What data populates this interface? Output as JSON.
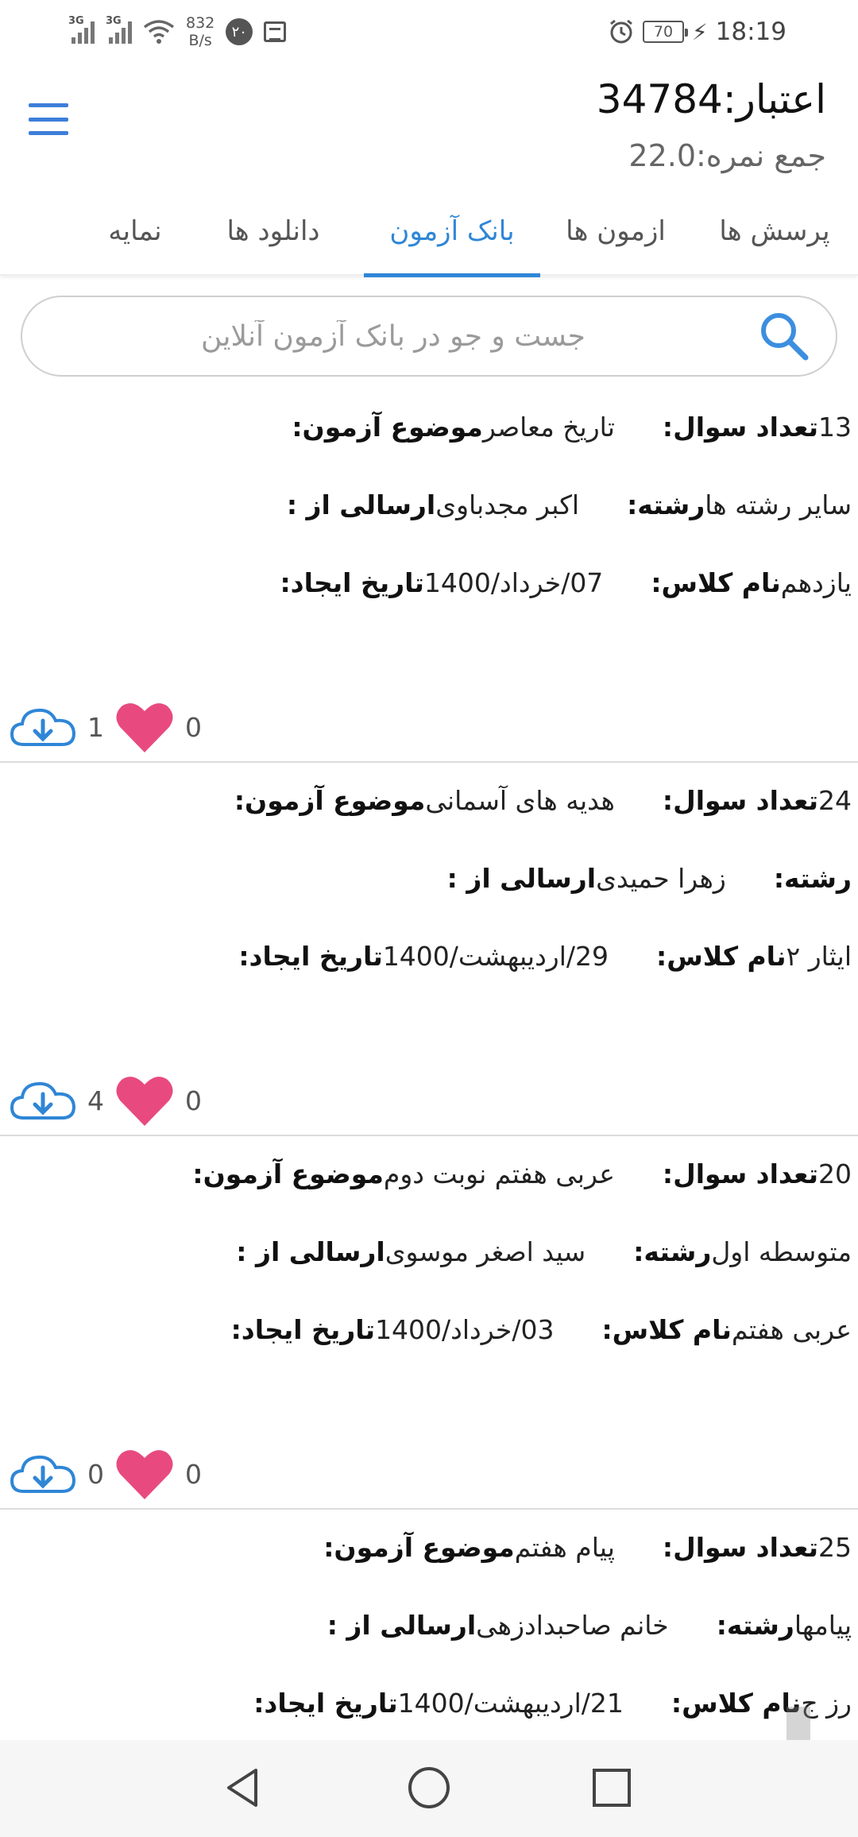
{
  "status_bar": {
    "net1": "3G",
    "net2": "3G",
    "speed_value": "832",
    "speed_unit": "B/s",
    "badge": "۲۰",
    "battery": "70",
    "time": "18:19"
  },
  "header": {
    "credit": "اعتبار:34784",
    "score": "جمع نمره:22.0"
  },
  "tabs": [
    {
      "label": "پرسش ها"
    },
    {
      "label": "ازمون ها"
    },
    {
      "label": "بانک آزمون"
    },
    {
      "label": "دانلود ها"
    },
    {
      "label": "نمایه"
    }
  ],
  "active_tab": 2,
  "search": {
    "placeholder": "جست و جو در بانک آزمون آنلاین"
  },
  "labels": {
    "subject": "موضوع آزمون:",
    "count": "تعداد سوال:",
    "sender": "ارسالی از :",
    "field": "رشته:",
    "date": "تاریخ ایجاد:",
    "class": "نام کلاس:"
  },
  "exams": [
    {
      "subject": "تاریخ معاصر",
      "count": "13",
      "sender": "اکبر مجدباوی",
      "field": "سایر رشته ها",
      "date": "07/خرداد/1400",
      "class": "یازدهم",
      "likes": "0",
      "downloads": "1"
    },
    {
      "subject": "هدیه های آسمانی",
      "count": "24",
      "sender": "زهرا حمیدی",
      "field": "",
      "date": "29/اردیبهشت/1400",
      "class": "ایثار ۲",
      "likes": "0",
      "downloads": "4"
    },
    {
      "subject": "عربی هفتم نوبت دوم",
      "count": "20",
      "sender": "سید اصغر موسوی",
      "field": "متوسطه اول",
      "date": "03/خرداد/1400",
      "class": "عربی هفتم",
      "likes": "0",
      "downloads": "0"
    },
    {
      "subject": "پیام هفتم",
      "count": "25",
      "sender": "خانم صاحبدادزهی",
      "field": "پیامها",
      "date": "21/اردیبهشت/1400",
      "class": "رز ج",
      "likes": "",
      "downloads": ""
    }
  ],
  "colors": {
    "accent": "#2f86d6",
    "heart": "#e84a7f",
    "menu": "#3c7ed9"
  },
  "icons": [
    "alarm-icon",
    "battery-icon",
    "news-icon",
    "wifi-icon",
    "signal-icon",
    "menu-icon",
    "search-icon",
    "heart-icon",
    "cloud-download-icon",
    "back-icon",
    "home-icon",
    "recents-icon"
  ]
}
